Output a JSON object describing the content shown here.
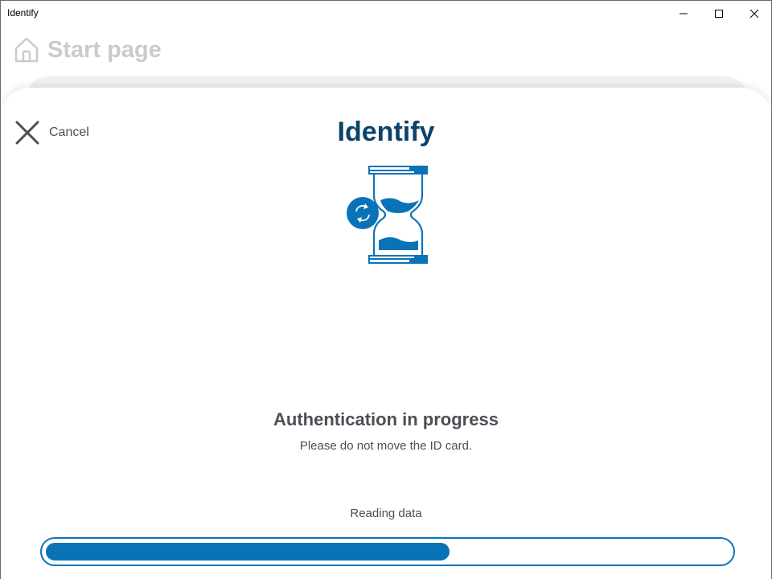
{
  "window": {
    "title": "Identify"
  },
  "background_page": {
    "title": "Start page",
    "icon": "home-icon"
  },
  "dialog": {
    "cancel_label": "Cancel",
    "cancel_icon": "close-icon",
    "heading": "Identify",
    "illustration": "hourglass-icon",
    "status_title": "Authentication in progress",
    "status_message": "Please do not move the ID card.",
    "progress_label": "Reading data",
    "progress_value": 0.59
  },
  "colors": {
    "accent": "#0a73b7",
    "heading": "#0a4468",
    "text": "#4a4f55",
    "muted": "#c8cbcf"
  }
}
